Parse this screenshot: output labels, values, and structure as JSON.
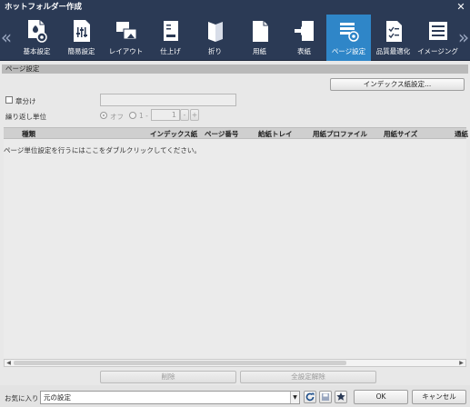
{
  "window": {
    "title": "ホットフォルダー作成"
  },
  "toolbar": {
    "items": [
      {
        "label": "基本設定",
        "icon": "basic-settings-icon"
      },
      {
        "label": "簡易設定",
        "icon": "simple-settings-icon"
      },
      {
        "label": "レイアウト",
        "icon": "layout-icon"
      },
      {
        "label": "仕上げ",
        "icon": "finishing-icon"
      },
      {
        "label": "折り",
        "icon": "fold-icon"
      },
      {
        "label": "用紙",
        "icon": "paper-icon"
      },
      {
        "label": "表紙",
        "icon": "cover-icon"
      },
      {
        "label": "ページ設定",
        "icon": "page-settings-icon",
        "active": true
      },
      {
        "label": "品質最適化",
        "icon": "quality-optimization-icon"
      },
      {
        "label": "イメージング",
        "icon": "imaging-icon"
      }
    ],
    "active_color": "#2f86c8"
  },
  "section": {
    "title": "ページ設定"
  },
  "index_button": {
    "label": "インデックス紙設定..."
  },
  "chapter": {
    "label": "章分け"
  },
  "repeat": {
    "label": "繰り返し単位",
    "off_label": "オフ",
    "on_label": "1 -",
    "value": "1",
    "minus": "-",
    "plus": "+"
  },
  "table": {
    "headers": [
      "種類",
      "インデックス紙",
      "ページ番号",
      "給紙トレイ",
      "用紙プロファイル",
      "用紙サイズ",
      "通紙"
    ],
    "hint": "ページ単位設定を行うにはここをダブルクリックしてください。"
  },
  "actions": {
    "delete": "削除",
    "delete_all": "全設定解除"
  },
  "footer": {
    "favorites_label": "お気に入り",
    "favorites_value": "元の設定",
    "ok": "OK",
    "cancel": "キャンセル"
  }
}
